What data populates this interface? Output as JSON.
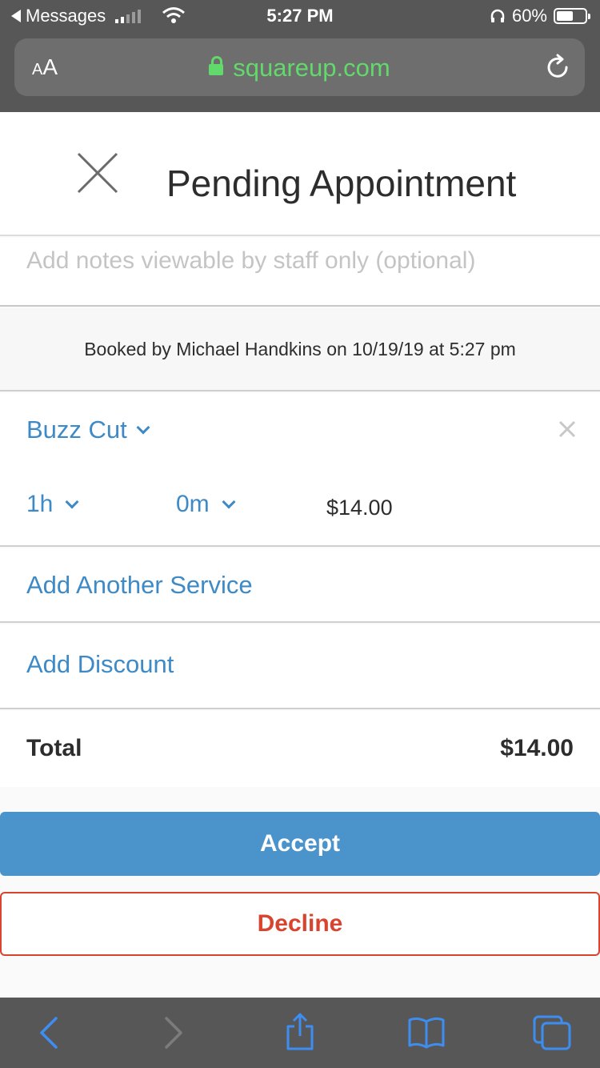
{
  "status_bar": {
    "back_app": "Messages",
    "time": "5:27 PM",
    "battery": "60%",
    "battery_level": 0.6
  },
  "browser": {
    "text_size_label_small": "A",
    "text_size_label_large": "A",
    "url": "squareup.com"
  },
  "header": {
    "title": "Pending Appointment"
  },
  "notes": {
    "placeholder": "Add notes viewable by staff only (optional)"
  },
  "booked_info": "Booked by Michael Handkins on 10/19/19 at 5:27 pm",
  "service": {
    "name": "Buzz Cut",
    "hours": "1h",
    "minutes": "0m",
    "price": "$14.00"
  },
  "actions": {
    "add_service": "Add Another Service",
    "add_discount": "Add Discount"
  },
  "total": {
    "label": "Total",
    "value": "$14.00"
  },
  "buttons": {
    "accept": "Accept",
    "decline": "Decline"
  },
  "colors": {
    "accent_blue": "#3d8ac7",
    "accept_bg": "#4a93cb",
    "decline_red": "#d9442f",
    "url_green": "#62d96b",
    "chrome_gray": "#575757"
  }
}
